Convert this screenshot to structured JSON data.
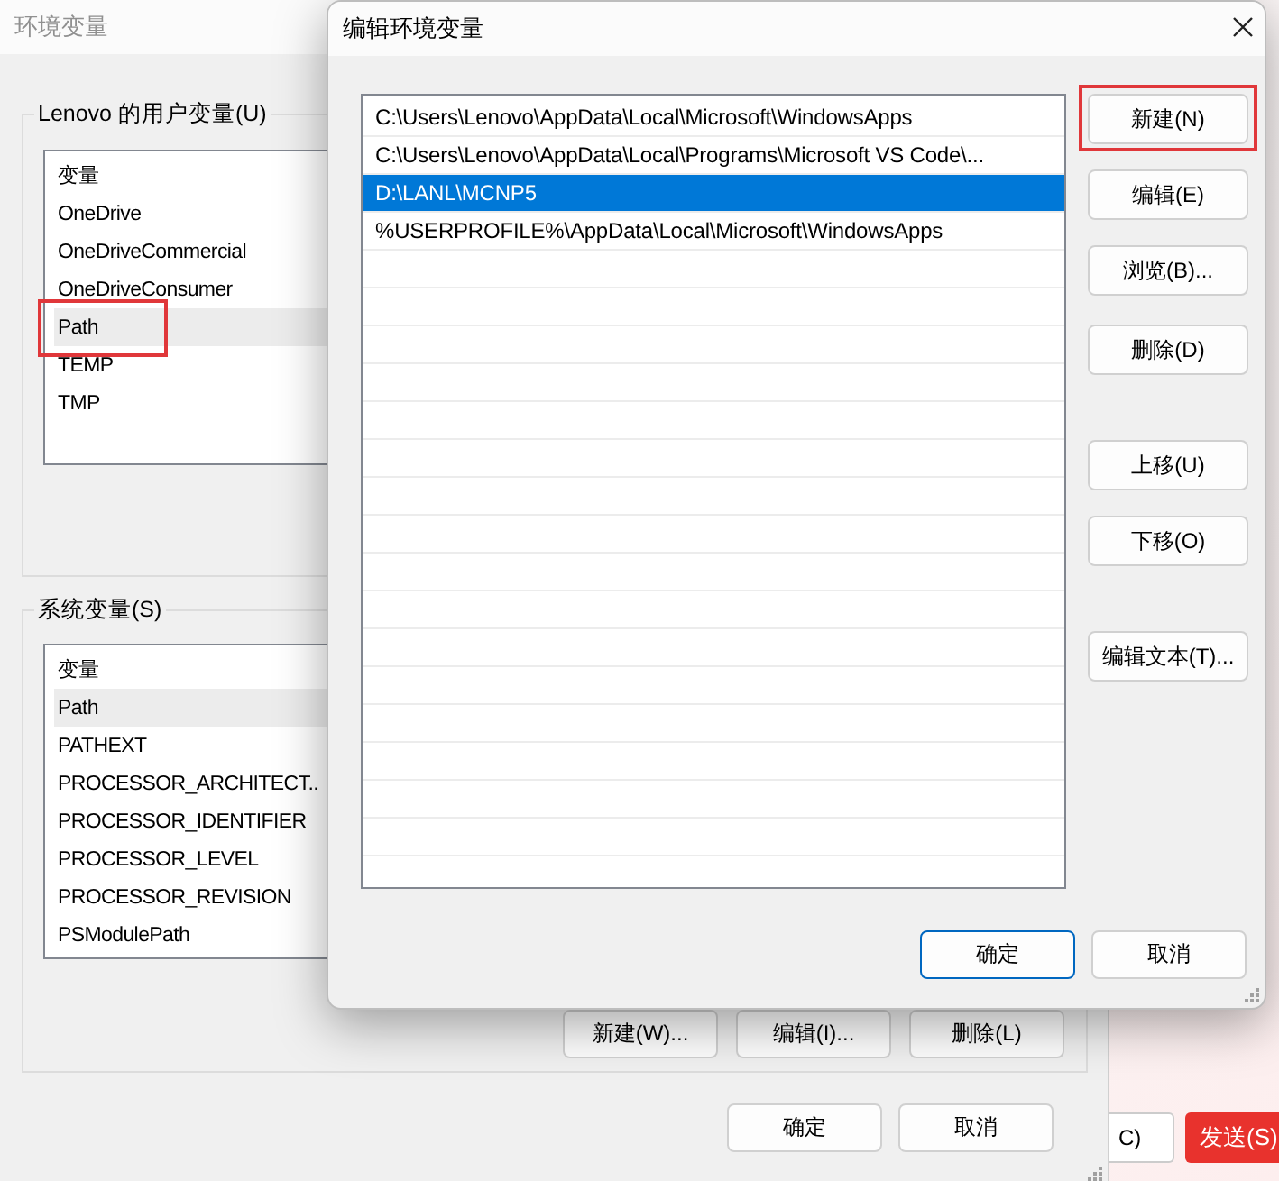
{
  "behind_app": {
    "buttons": [
      {
        "label": "C)",
        "kind": "plain"
      },
      {
        "label": "发送(S)",
        "kind": "primary"
      }
    ]
  },
  "background_window": {
    "title": "环境变量",
    "user_vars": {
      "label": "Lenovo 的用户变量(U)",
      "column": "变量",
      "items": [
        {
          "name": "OneDrive",
          "hovered": false,
          "highlighted": false
        },
        {
          "name": "OneDriveCommercial",
          "hovered": false,
          "highlighted": false
        },
        {
          "name": "OneDriveConsumer",
          "hovered": false,
          "highlighted": false
        },
        {
          "name": "Path",
          "hovered": true,
          "highlighted": true
        },
        {
          "name": "TEMP",
          "hovered": false,
          "highlighted": false
        },
        {
          "name": "TMP",
          "hovered": false,
          "highlighted": false
        }
      ]
    },
    "system_vars": {
      "label": "系统变量(S)",
      "column": "变量",
      "items": [
        {
          "name": "Path",
          "hovered": true,
          "highlighted": false
        },
        {
          "name": "PATHEXT",
          "hovered": false,
          "highlighted": false
        },
        {
          "name": "PROCESSOR_ARCHITECT..",
          "hovered": false,
          "highlighted": false
        },
        {
          "name": "PROCESSOR_IDENTIFIER",
          "hovered": false,
          "highlighted": false
        },
        {
          "name": "PROCESSOR_LEVEL",
          "hovered": false,
          "highlighted": false
        },
        {
          "name": "PROCESSOR_REVISION",
          "hovered": false,
          "highlighted": false
        },
        {
          "name": "PSModulePath",
          "hovered": false,
          "highlighted": false
        }
      ],
      "buttons": [
        "新建(W)...",
        "编辑(I)...",
        "删除(L)"
      ]
    },
    "buttons": [
      "确定",
      "取消"
    ]
  },
  "dialog": {
    "title": "编辑环境变量",
    "entries": [
      {
        "path": "C:\\Users\\Lenovo\\AppData\\Local\\Microsoft\\WindowsApps",
        "selected": false
      },
      {
        "path": "C:\\Users\\Lenovo\\AppData\\Local\\Programs\\Microsoft VS Code\\...",
        "selected": false
      },
      {
        "path": "D:\\LANL\\MCNP5",
        "selected": true
      },
      {
        "path": "%USERPROFILE%\\AppData\\Local\\Microsoft\\WindowsApps",
        "selected": false
      }
    ],
    "buttons": [
      {
        "label": "新建(N)",
        "highlighted": true
      },
      {
        "label": "编辑(E)",
        "highlighted": false
      },
      {
        "label": "浏览(B)...",
        "highlighted": false
      },
      {
        "label": "删除(D)",
        "highlighted": false
      },
      {
        "label": "上移(U)",
        "highlighted": false
      },
      {
        "label": "下移(O)",
        "highlighted": false
      },
      {
        "label": "编辑文本(T)...",
        "highlighted": false
      }
    ],
    "footer_buttons": [
      {
        "label": "确定",
        "default": true
      },
      {
        "label": "取消",
        "default": false
      }
    ]
  }
}
